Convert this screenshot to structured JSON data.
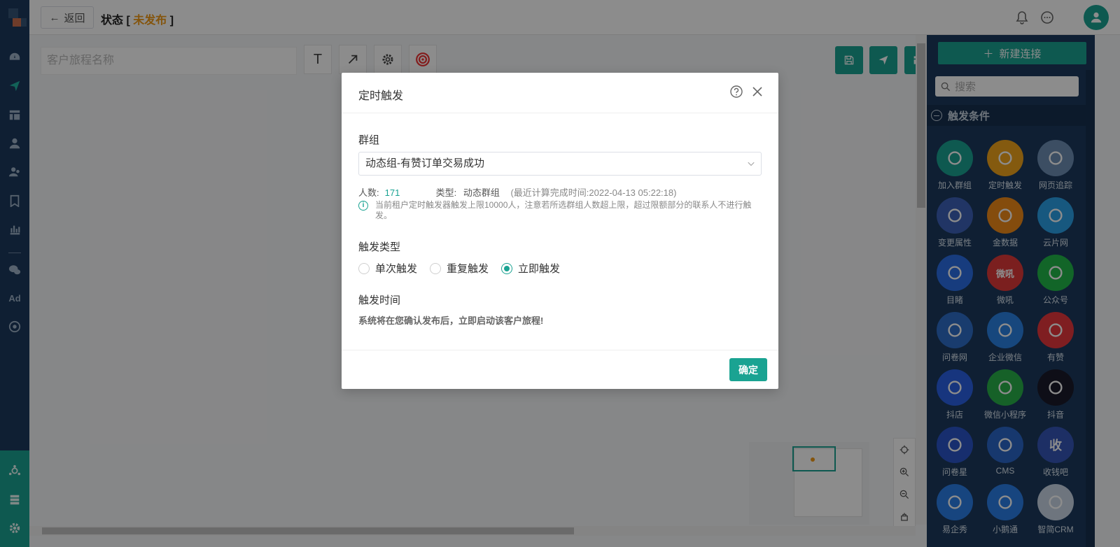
{
  "header": {
    "back_label": "返回",
    "status_prefix": "状态 [ ",
    "status_value": "未发布",
    "status_suffix": " ]"
  },
  "toolbar": {
    "journey_name_placeholder": "客户旅程名称",
    "text_tool": "T"
  },
  "right_panel": {
    "new_connection_label": "新建连接",
    "search_placeholder": "搜索",
    "section_title": "触发条件",
    "items": [
      {
        "label": "加入群组",
        "icon": "add-user-icon",
        "color": "#1aa392"
      },
      {
        "label": "定时触发",
        "icon": "clock-icon",
        "color": "#f0a41c"
      },
      {
        "label": "网页追踪",
        "icon": "browser-icon",
        "color": "#6d8fb5"
      },
      {
        "label": "变更属性",
        "icon": "edit-icon",
        "color": "#3d62b8"
      },
      {
        "label": "金数据",
        "icon": "jinshuju-icon",
        "color": "#f08a18"
      },
      {
        "label": "云片网",
        "icon": "yunpian-icon",
        "color": "#2aa0e8"
      },
      {
        "label": "目睹",
        "icon": "play-icon",
        "color": "#2a6ee6"
      },
      {
        "label": "微吼",
        "icon": "vhall-icon",
        "color": "#e03a3a",
        "glyph": "微吼"
      },
      {
        "label": "公众号",
        "icon": "wechat-icon",
        "color": "#22b84a"
      },
      {
        "label": "问卷网",
        "icon": "wenjuan-icon",
        "color": "#2f6ec8"
      },
      {
        "label": "企业微信",
        "icon": "wework-icon",
        "color": "#2a82e4"
      },
      {
        "label": "有赞",
        "icon": "thumbs-up-icon",
        "color": "#e8383d"
      },
      {
        "label": "抖店",
        "icon": "doudian-icon",
        "color": "#2a62e6"
      },
      {
        "label": "微信小程序",
        "icon": "miniprogram-icon",
        "color": "#28b14a"
      },
      {
        "label": "抖音",
        "icon": "tiktok-icon",
        "color": "#1a1a2a"
      },
      {
        "label": "问卷星",
        "icon": "star-icon",
        "color": "#2a55c8"
      },
      {
        "label": "CMS",
        "icon": "cms-icon",
        "color": "#2a66c8"
      },
      {
        "label": "收钱吧",
        "icon": "shouqianba-icon",
        "color": "#3556b8",
        "glyph": "收"
      },
      {
        "label": "易企秀",
        "icon": "eqxiu-icon",
        "color": "#2a7ee8"
      },
      {
        "label": "小鹅通",
        "icon": "xiaoetong-icon",
        "color": "#2a7ee8"
      },
      {
        "label": "智简CRM",
        "icon": "crm-icon",
        "color": "#c8d6e6"
      }
    ]
  },
  "modal": {
    "title": "定时触发",
    "group_label": "群组",
    "group_value": "动态组-有赞订单交易成功",
    "count_label": "人数:",
    "count_value": "171",
    "type_label": "类型:",
    "type_value": "动态群组",
    "calc_time": "(最近计算完成时间:2022-04-13 05:22:18)",
    "notice": "当前租户定时触发器触发上限10000人，注意若所选群组人数超上限，超过限额部分的联系人不进行触发。",
    "trigger_type_label": "触发类型",
    "trigger_options": [
      "单次触发",
      "重复触发",
      "立即触发"
    ],
    "trigger_selected": "立即触发",
    "trigger_time_label": "触发时间",
    "trigger_time_note": "系统将在您确认发布后，立即启动该客户旅程!",
    "ok_label": "确定"
  },
  "colors": {
    "accent": "#1aa392",
    "nav_bg": "#1c3a5e",
    "status_unpublished": "#f09a16"
  }
}
